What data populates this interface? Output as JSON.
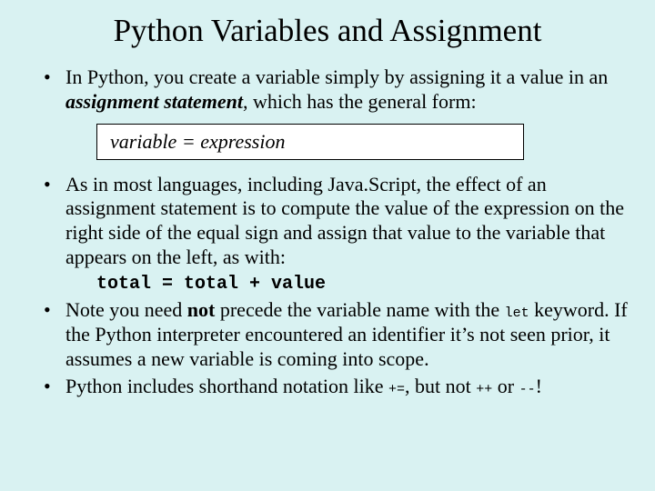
{
  "title": "Python Variables and Assignment",
  "bullets": {
    "b1": {
      "t1": "In Python, you create a variable simply by assigning it a value in an ",
      "emph": "assignment statement",
      "t2": ", which has the general form:"
    },
    "syntax": {
      "var": "variable",
      "eq": "  =  ",
      "expr": "expression"
    },
    "b2": {
      "text": "As in most languages, including Java.Script, the effect of an assignment statement is to compute the value of the expression on the right side of the equal sign and assign that value to the variable that appears on the left, as with:"
    },
    "code": "total = total + value",
    "b3": {
      "t1": "Note you need ",
      "bold": "not",
      "t2": " precede the variable name with the ",
      "kw": "let",
      "t3": " keyword.  If the Python interpreter encountered an identifier it’s not seen prior, it assumes a new variable is coming into scope."
    },
    "b4": {
      "t1": "Python includes shorthand notation like ",
      "op1": "+=",
      "t2": ", but not ",
      "op2": "++",
      "t3": " or ",
      "op3": "--",
      "t4": "!"
    }
  }
}
